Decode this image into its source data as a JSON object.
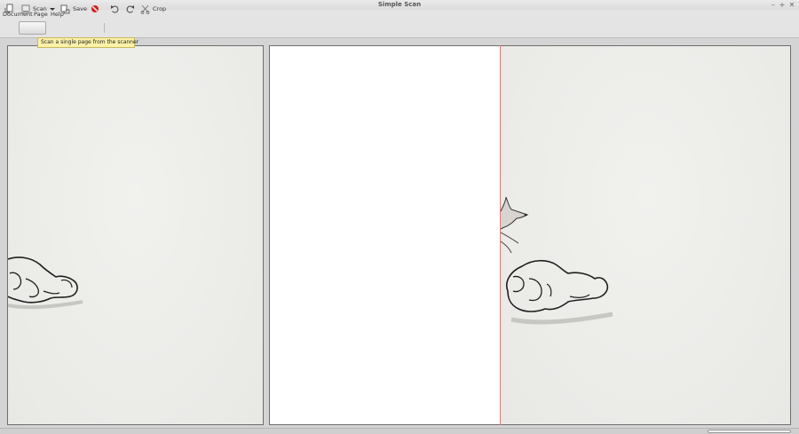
{
  "window": {
    "title": "Simple Scan",
    "controls": [
      "–",
      "+",
      "✕"
    ]
  },
  "menu": {
    "items": [
      "Document",
      "Page",
      "Help"
    ]
  },
  "toolbar": {
    "new_icon": "new-document-icon",
    "scan_label": "Scan",
    "scan_icon": "scanner-icon",
    "scan_menu_icon": "dropdown-arrow-icon",
    "save_label": "Save",
    "save_icon": "save-icon",
    "stop_icon": "stop-icon",
    "rotate_left_icon": "rotate-left-icon",
    "rotate_right_icon": "rotate-right-icon",
    "crop_label": "Crop",
    "crop_icon": "crop-icon"
  },
  "tooltip": {
    "text": "Scan a single page from the scanner"
  },
  "pages": [
    {
      "name": "scanned-page-1",
      "state": "scanned"
    },
    {
      "name": "scanned-page-2",
      "state": "scanning"
    },
    {
      "name": "scanned-page-3",
      "state": "scanned"
    }
  ],
  "colors": {
    "scan_line": "#e07a7a",
    "tooltip_bg": "#fbf1a8",
    "stop_icon": "#d42020"
  }
}
